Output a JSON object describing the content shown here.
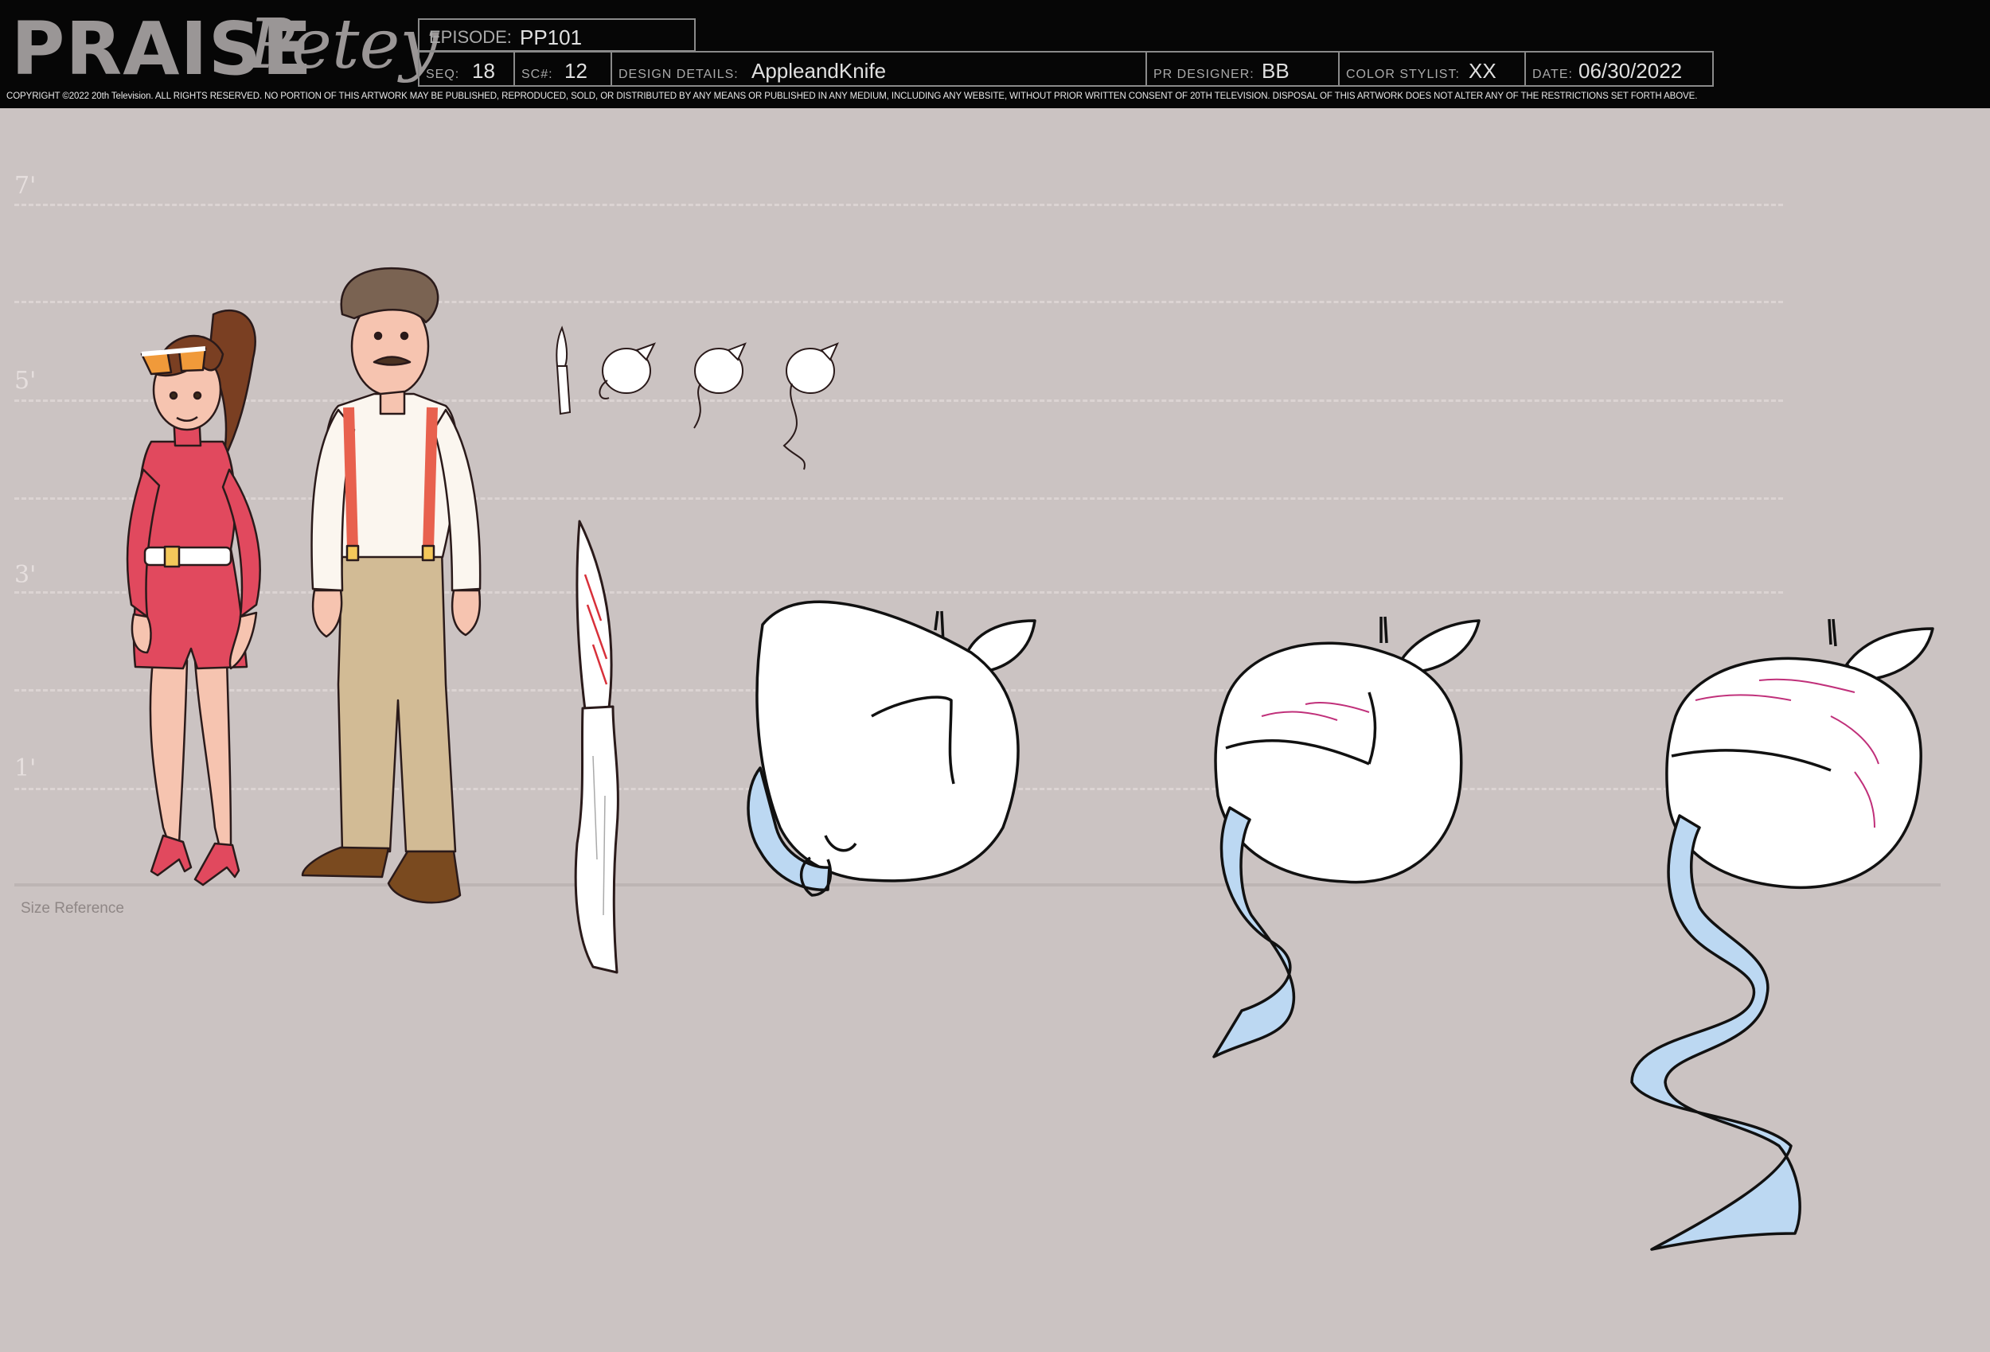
{
  "header": {
    "logo_main": "PRAISE",
    "logo_script": "Petey",
    "episode": {
      "label": "EPISODE:",
      "value": "PP101"
    },
    "seq": {
      "label": "SEQ:",
      "value": "18"
    },
    "sc": {
      "label": "SC#:",
      "value": "12"
    },
    "design_details": {
      "label": "DESIGN DETAILS:",
      "value": "AppleandKnife"
    },
    "pr_designer": {
      "label": "PR DESIGNER:",
      "value": "BB"
    },
    "color_stylist": {
      "label": "COLOR STYLIST:",
      "value": "XX"
    },
    "date": {
      "label": "DATE:",
      "value": "06/30/2022"
    },
    "copyright": "COPYRIGHT ©2022 20th Television. ALL RIGHTS RESERVED. NO PORTION OF THIS ARTWORK MAY BE PUBLISHED, REPRODUCED, SOLD, OR DISTRIBUTED BY ANY MEANS OR PUBLISHED IN ANY MEDIUM, INCLUDING ANY WEBSITE, WITHOUT PRIOR WRITTEN CONSENT OF 20TH TELEVISION. DISPOSAL OF THIS ARTWORK DOES NOT ALTER ANY OF THE RESTRICTIONS SET FORTH ABOVE."
  },
  "ruler": {
    "labels": [
      "7'",
      "5'",
      "3'",
      "1'"
    ],
    "size_reference": "Size Reference"
  },
  "colors": {
    "background": "#cbc3c2",
    "header_bg": "#060606",
    "woman_outfit": "#e1495e",
    "suspenders": "#e8614e",
    "pants": "#d2bb95",
    "shoes": "#7a4a1f",
    "hair_brown": "#7a3f22",
    "peel_blue": "#bcd8f2",
    "cut_marks": "#c0307a",
    "knife_marks": "#d8303a"
  },
  "icons": [
    "woman-character",
    "man-character",
    "knife-icon",
    "apple-icon"
  ]
}
